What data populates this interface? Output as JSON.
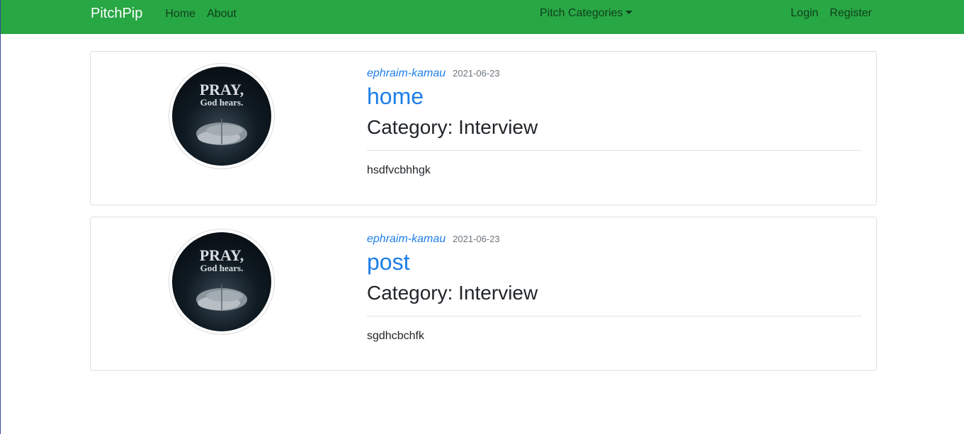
{
  "nav": {
    "brand": "PitchPip",
    "links": [
      "Home",
      "About"
    ],
    "dropdown": "Pitch Categories",
    "right": [
      "Login",
      "Register"
    ]
  },
  "posts": [
    {
      "author": "ephraim-kamau",
      "date": "2021-06-23",
      "title": "home",
      "category": "Category: Interview",
      "body": "hsdfvcbhhgk",
      "image_text": [
        "PRAY,",
        "God hears."
      ]
    },
    {
      "author": "ephraim-kamau",
      "date": "2021-06-23",
      "title": "post",
      "category": "Category: Interview",
      "body": "sgdhcbchfk",
      "image_text": [
        "PRAY,",
        "God hears."
      ]
    }
  ]
}
